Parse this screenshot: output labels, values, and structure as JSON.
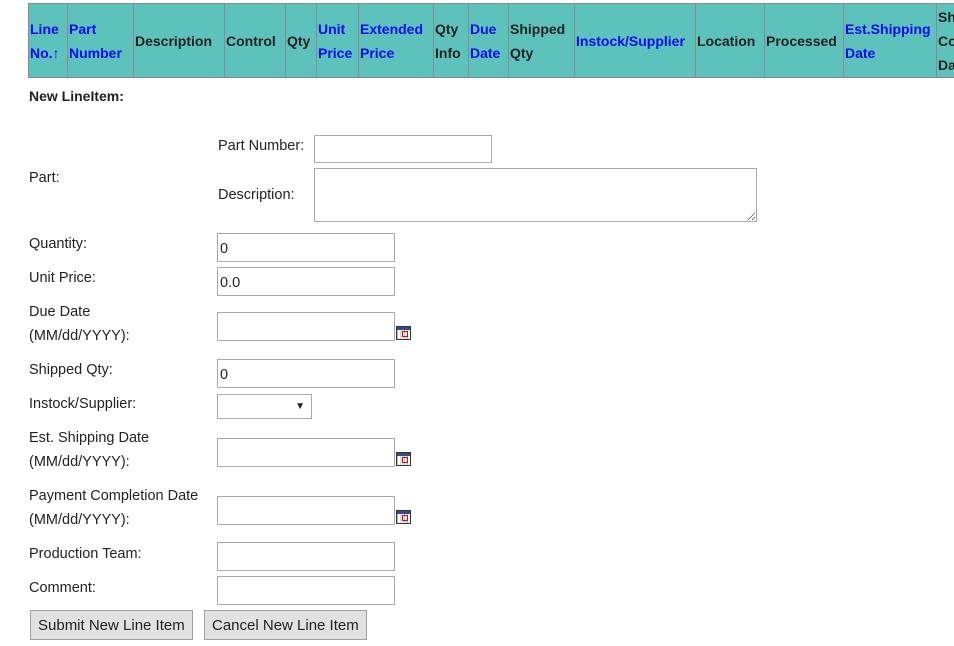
{
  "grid": {
    "columns": [
      {
        "label": "Line No.↑",
        "link": true
      },
      {
        "label": "Part Number",
        "link": true
      },
      {
        "label": "Description",
        "link": false
      },
      {
        "label": "Control",
        "link": false
      },
      {
        "label": "Qty",
        "link": false
      },
      {
        "label": "Unit Price",
        "link": true
      },
      {
        "label": "Extended Price",
        "link": true
      },
      {
        "label": "Qty Info",
        "link": false
      },
      {
        "label": "Due Date",
        "link": true
      },
      {
        "label": "Shipped Qty",
        "link": false
      },
      {
        "label": "Instock/Supplier",
        "link": true
      },
      {
        "label": "Location",
        "link": false
      },
      {
        "label": "Processed",
        "link": false
      },
      {
        "label": "Est.Shipping Date",
        "link": true
      },
      {
        "label": "Sh Co Da",
        "link": false
      }
    ]
  },
  "form": {
    "title": "New LineItem:",
    "part_label": "Part:",
    "part_number_label": "Part Number:",
    "part_number_value": "",
    "description_label": "Description:",
    "description_value": "",
    "quantity_label": "Quantity:",
    "quantity_value": "0",
    "unit_price_label": "Unit Price:",
    "unit_price_value": "0.0",
    "due_date_label": "Due Date",
    "due_date_format": "(MM/dd/YYYY):",
    "due_date_value": "",
    "shipped_qty_label": "Shipped Qty:",
    "shipped_qty_value": "0",
    "instock_label": "Instock/Supplier:",
    "instock_value": "",
    "est_ship_label": "Est. Shipping Date",
    "est_ship_format": "(MM/dd/YYYY):",
    "est_ship_value": "",
    "payment_label": "Payment Completion Date",
    "payment_format": "(MM/dd/YYYY):",
    "payment_value": "",
    "production_label": "Production Team:",
    "production_value": "",
    "comment_label": "Comment:",
    "comment_value": "",
    "submit": "Submit New Line Item",
    "cancel": "Cancel New Line Item"
  }
}
